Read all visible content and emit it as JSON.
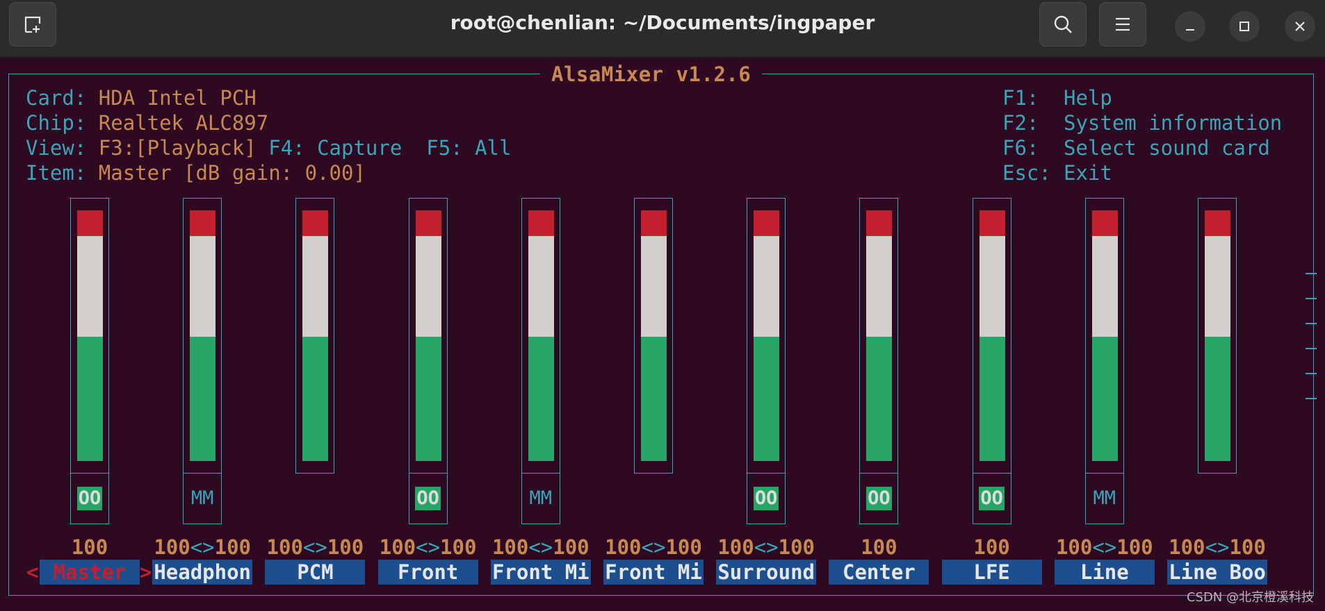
{
  "window": {
    "title": "root@chenlian: ~/Documents/ingpaper",
    "buttons": [
      "new-tab-icon",
      "search-icon",
      "menu-icon",
      "minimize-icon",
      "maximize-icon",
      "close-icon"
    ]
  },
  "mixer": {
    "title": "AlsaMixer v1.2.6",
    "info": {
      "card_label": "Card:",
      "card_value": "HDA Intel PCH",
      "chip_label": "Chip:",
      "chip_value": "Realtek ALC897",
      "view_label": "View:",
      "view_f3": "F3:",
      "view_playback": "[Playback]",
      "view_f4": "F4: Capture",
      "view_f5": "F5: All",
      "item_label": "Item:",
      "item_value": "Master [dB gain: 0.00]"
    },
    "keys": [
      {
        "key": "F1:",
        "action": "Help"
      },
      {
        "key": "F2:",
        "action": "System information"
      },
      {
        "key": "F6:",
        "action": "Select sound card"
      },
      {
        "key": "Esc:",
        "action": "Exit"
      }
    ],
    "left_arrow": "<",
    "right_arrow": ">",
    "controls": [
      {
        "name": "Master",
        "vol_left": "100",
        "sep": "",
        "vol_right": "",
        "switch": "OO",
        "level": 1.0,
        "selected": true
      },
      {
        "name": "Headphon",
        "vol_left": "100",
        "sep": "<>",
        "vol_right": "100",
        "switch": "MM",
        "level": 1.0
      },
      {
        "name": "PCM",
        "vol_left": "100",
        "sep": "<>",
        "vol_right": "100",
        "switch": "",
        "level": 1.0
      },
      {
        "name": "Front",
        "vol_left": "100",
        "sep": "<>",
        "vol_right": "100",
        "switch": "OO",
        "level": 1.0
      },
      {
        "name": "Front Mi",
        "vol_left": "100",
        "sep": "<>",
        "vol_right": "100",
        "switch": "MM",
        "level": 1.0
      },
      {
        "name": "Front Mi",
        "vol_left": "100",
        "sep": "<>",
        "vol_right": "100",
        "switch": "",
        "level": 1.0
      },
      {
        "name": "Surround",
        "vol_left": "100",
        "sep": "<>",
        "vol_right": "100",
        "switch": "OO",
        "level": 1.0
      },
      {
        "name": "Center",
        "vol_left": "100",
        "sep": "",
        "vol_right": "",
        "switch": "OO",
        "level": 1.0
      },
      {
        "name": "LFE",
        "vol_left": "100",
        "sep": "",
        "vol_right": "",
        "switch": "OO",
        "level": 1.0
      },
      {
        "name": "Line",
        "vol_left": "100",
        "sep": "<>",
        "vol_right": "100",
        "switch": "MM",
        "level": 1.0
      },
      {
        "name": "Line Boo",
        "vol_left": "100",
        "sep": "<>",
        "vol_right": "100",
        "switch": "",
        "level": 1.0
      }
    ]
  },
  "watermark": "CSDN @北京橙溪科技",
  "colors": {
    "background": "#2d0922",
    "border": "#3aa4b8",
    "value": "#c8884f",
    "meter_red": "#c3202f",
    "meter_white": "#d3cfcd",
    "meter_green": "#27a567",
    "name_bg": "#1d4f8f"
  }
}
